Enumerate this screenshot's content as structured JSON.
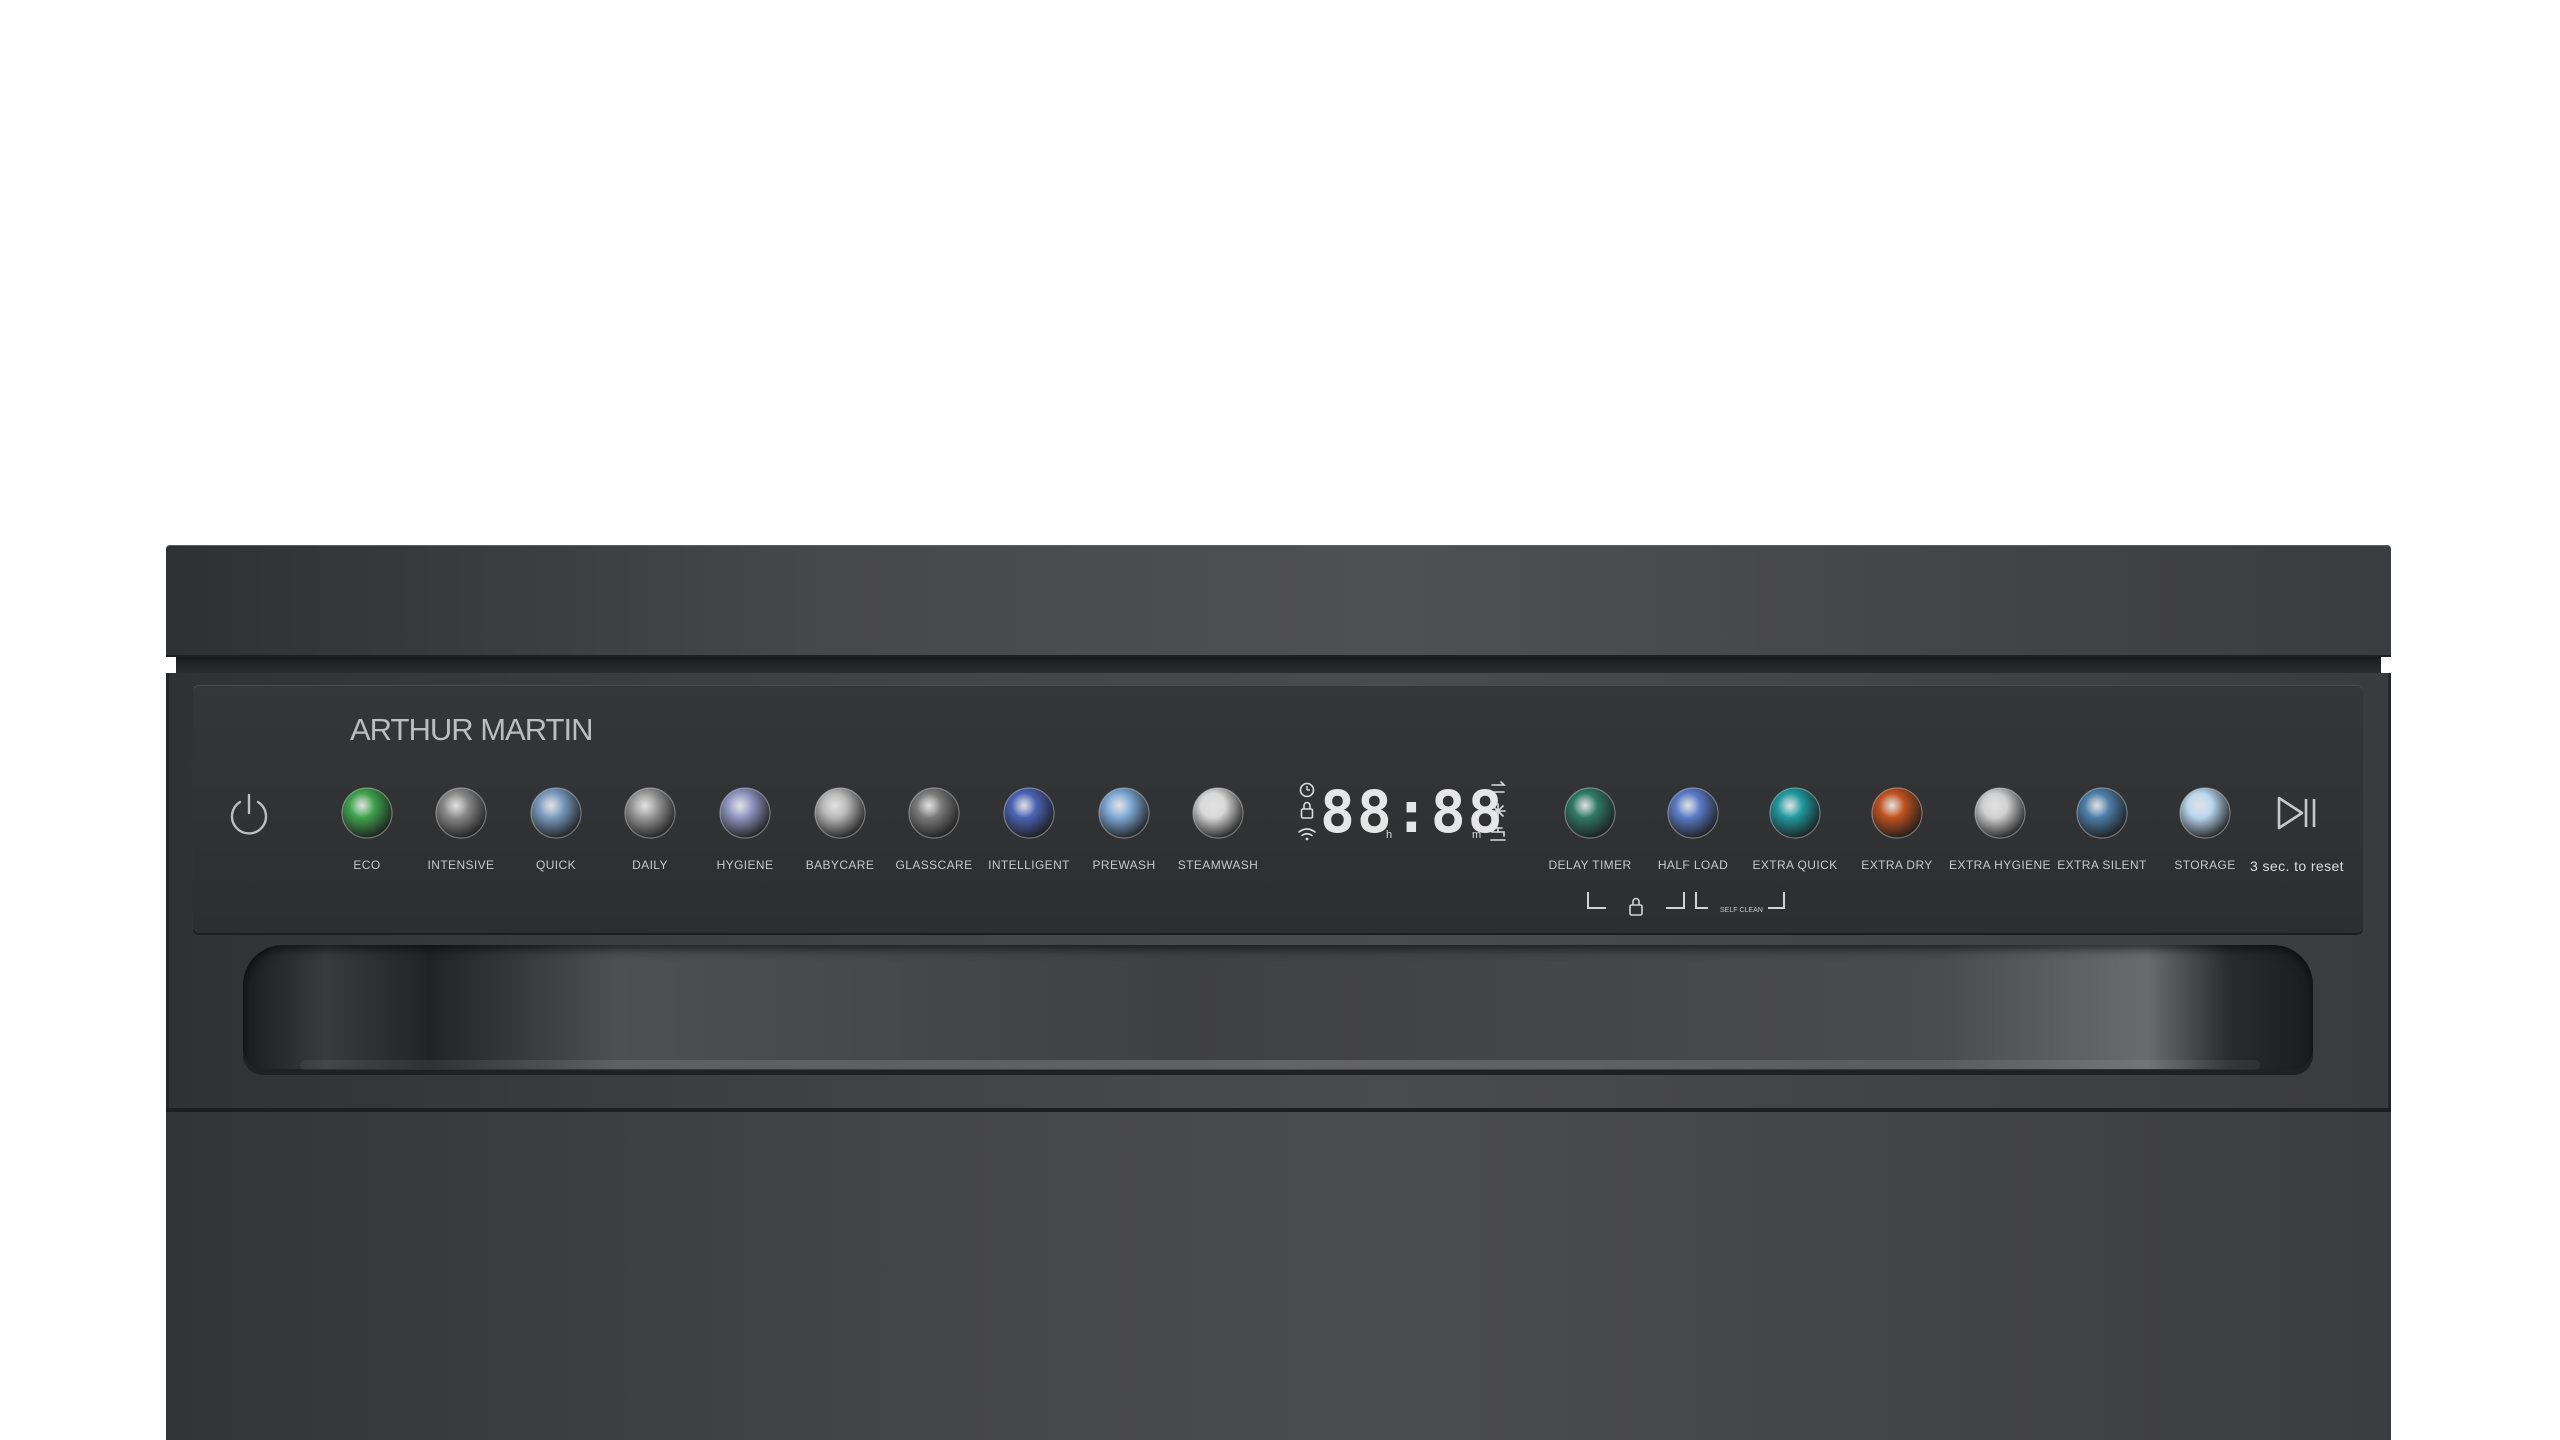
{
  "brand": "ARTHUR MARTIN",
  "display": {
    "digits": "88:88",
    "unit_h": "h",
    "unit_m": "m",
    "left_icons": [
      "clock-icon",
      "lock-icon",
      "wifi-icon"
    ],
    "right_icons": [
      "rinse-aid-icon",
      "salt-icon",
      "tap-icon"
    ]
  },
  "programs": [
    {
      "label": "ECO",
      "icon": "leaf-icon",
      "color": "#3fa34d"
    },
    {
      "label": "INTENSIVE",
      "icon": "intensive-icon",
      "color": "#8a8a8a"
    },
    {
      "label": "QUICK",
      "icon": "quick-icon",
      "color": "#7a9cc0"
    },
    {
      "label": "DAILY",
      "icon": "daily-icon",
      "color": "#9a9a9a"
    },
    {
      "label": "HYGIENE",
      "icon": "hygiene-icon",
      "color": "#8f96c2"
    },
    {
      "label": "BABYCARE",
      "icon": "babycare-icon",
      "color": "#b8b8b8"
    },
    {
      "label": "GLASSCARE",
      "icon": "glass-icon",
      "color": "#7b7b7b"
    },
    {
      "label": "INTELLIGENT",
      "icon": "intelligent-icon",
      "color": "#4b63b5"
    },
    {
      "label": "PREWASH",
      "icon": "prewash-icon",
      "color": "#7eaad6"
    },
    {
      "label": "STEAMWASH",
      "icon": "steam-icon",
      "color": "#d8d8d8"
    }
  ],
  "options": [
    {
      "label": "DELAY TIMER",
      "icon": "delay-timer-icon",
      "color": "#2f7a63"
    },
    {
      "label": "HALF LOAD",
      "icon": "half-load-icon",
      "color": "#5a7cc8"
    },
    {
      "label": "EXTRA QUICK",
      "icon": "extra-quick-icon",
      "color": "#1f9aa0"
    },
    {
      "label": "EXTRA DRY",
      "icon": "extra-dry-icon",
      "color": "#c0521f"
    },
    {
      "label": "EXTRA HYGIENE",
      "icon": "extra-hygiene-icon",
      "color": "#d0d0d0"
    },
    {
      "label": "EXTRA SILENT",
      "icon": "extra-silent-icon",
      "color": "#4d7fa8"
    },
    {
      "label": "STORAGE",
      "icon": "storage-icon",
      "color": "#b9d7ef"
    }
  ],
  "start": {
    "label": "3 sec. to reset",
    "icon": "play-pause-icon"
  },
  "indicators": {
    "lock_icon": "lock-icon",
    "self_clean": "SELF CLEAN"
  }
}
